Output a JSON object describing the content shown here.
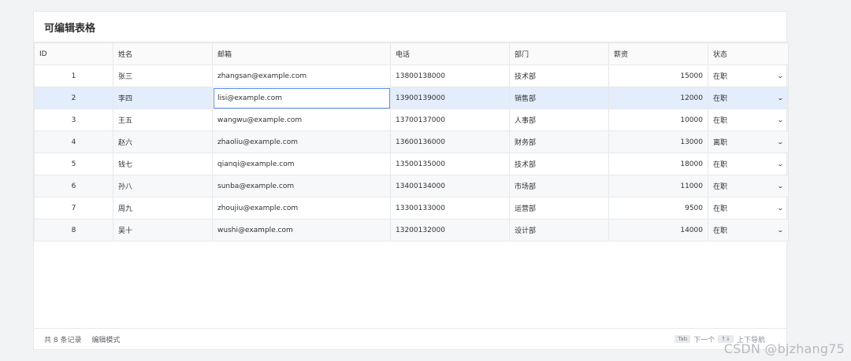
{
  "title": "可编辑表格",
  "columns": [
    "ID",
    "姓名",
    "邮箱",
    "电话",
    "部门",
    "薪资",
    "状态"
  ],
  "rows": [
    {
      "id": "1",
      "name": "张三",
      "email": "zhangsan@example.com",
      "phone": "13800138000",
      "dept": "技术部",
      "salary": "15000",
      "status": "在职"
    },
    {
      "id": "2",
      "name": "李四",
      "email": "lisi@example.com",
      "phone": "13900139000",
      "dept": "销售部",
      "salary": "12000",
      "status": "在职"
    },
    {
      "id": "3",
      "name": "王五",
      "email": "wangwu@example.com",
      "phone": "13700137000",
      "dept": "人事部",
      "salary": "10000",
      "status": "在职"
    },
    {
      "id": "4",
      "name": "赵六",
      "email": "zhaoliu@example.com",
      "phone": "13600136000",
      "dept": "财务部",
      "salary": "13000",
      "status": "离职"
    },
    {
      "id": "5",
      "name": "钱七",
      "email": "qianqi@example.com",
      "phone": "13500135000",
      "dept": "技术部",
      "salary": "18000",
      "status": "在职"
    },
    {
      "id": "6",
      "name": "孙八",
      "email": "sunba@example.com",
      "phone": "13400134000",
      "dept": "市场部",
      "salary": "11000",
      "status": "在职"
    },
    {
      "id": "7",
      "name": "周九",
      "email": "zhoujiu@example.com",
      "phone": "13300133000",
      "dept": "运营部",
      "salary": "9500",
      "status": "在职"
    },
    {
      "id": "8",
      "name": "吴十",
      "email": "wushi@example.com",
      "phone": "13200132000",
      "dept": "设计部",
      "salary": "14000",
      "status": "在职"
    }
  ],
  "footer": {
    "record_count": "共 8 条记录",
    "mode": "编辑模式",
    "tab_key": "Tab",
    "tab_hint": "下一个",
    "arrow_keys": "↑↓",
    "arrow_hint": "上下导航"
  },
  "watermark": "CSDN @bjzhang75",
  "colors": {
    "accent": "#5b8def",
    "selected_row": "#e4edfb"
  }
}
